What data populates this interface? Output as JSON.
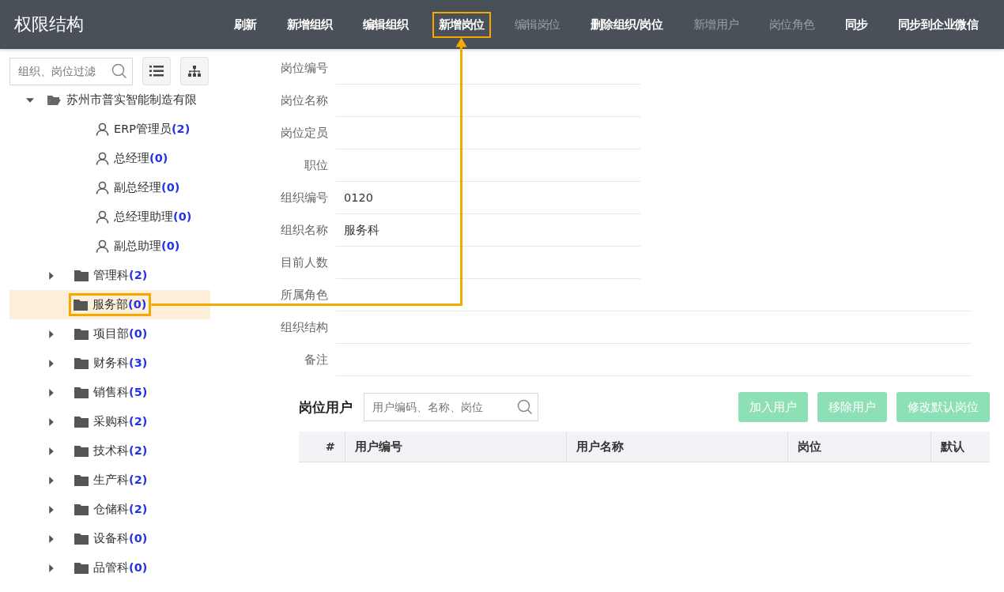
{
  "header": {
    "title": "权限结构"
  },
  "toolbar": [
    {
      "label": "刷新",
      "disabled": false,
      "highlighted": false
    },
    {
      "label": "新增组织",
      "disabled": false,
      "highlighted": false
    },
    {
      "label": "编辑组织",
      "disabled": false,
      "highlighted": false
    },
    {
      "label": "新增岗位",
      "disabled": false,
      "highlighted": true
    },
    {
      "label": "编辑岗位",
      "disabled": true,
      "highlighted": false
    },
    {
      "label": "删除组织/岗位",
      "disabled": false,
      "highlighted": false
    },
    {
      "label": "新增用户",
      "disabled": true,
      "highlighted": false
    },
    {
      "label": "岗位角色",
      "disabled": true,
      "highlighted": false
    },
    {
      "label": "同步",
      "disabled": false,
      "highlighted": false
    },
    {
      "label": "同步到企业微信",
      "disabled": false,
      "highlighted": false
    }
  ],
  "sidebar": {
    "search": {
      "placeholder": "组织、岗位过滤"
    },
    "tree": [
      {
        "kind": "org",
        "name": "苏州市普实智能制造有限",
        "expanded": true,
        "selected": false,
        "highlighted": false,
        "children": [
          {
            "kind": "post",
            "name": "ERP管理员",
            "count": "(2)",
            "selected": false,
            "highlighted": false
          },
          {
            "kind": "post",
            "name": "总经理",
            "count": "(0)",
            "selected": false,
            "highlighted": false
          },
          {
            "kind": "post",
            "name": "副总经理",
            "count": "(0)",
            "selected": false,
            "highlighted": false
          },
          {
            "kind": "post",
            "name": "总经理助理",
            "count": "(0)",
            "selected": false,
            "highlighted": false
          },
          {
            "kind": "post",
            "name": "副总助理",
            "count": "(0)",
            "selected": false,
            "highlighted": false
          },
          {
            "kind": "dept",
            "name": "管理科",
            "count": "(2)",
            "expandable": true,
            "selected": false,
            "highlighted": false
          },
          {
            "kind": "dept",
            "name": "服务部",
            "count": "(0)",
            "expandable": false,
            "selected": true,
            "highlighted": true
          },
          {
            "kind": "dept",
            "name": "项目部",
            "count": "(0)",
            "expandable": true,
            "selected": false,
            "highlighted": false
          },
          {
            "kind": "dept",
            "name": "财务科",
            "count": "(3)",
            "expandable": true,
            "selected": false,
            "highlighted": false
          },
          {
            "kind": "dept",
            "name": "销售科",
            "count": "(5)",
            "expandable": true,
            "selected": false,
            "highlighted": false
          },
          {
            "kind": "dept",
            "name": "采购科",
            "count": "(2)",
            "expandable": true,
            "selected": false,
            "highlighted": false
          },
          {
            "kind": "dept",
            "name": "技术科",
            "count": "(2)",
            "expandable": true,
            "selected": false,
            "highlighted": false
          },
          {
            "kind": "dept",
            "name": "生产科",
            "count": "(2)",
            "expandable": true,
            "selected": false,
            "highlighted": false
          },
          {
            "kind": "dept",
            "name": "仓储科",
            "count": "(2)",
            "expandable": true,
            "selected": false,
            "highlighted": false
          },
          {
            "kind": "dept",
            "name": "设备科",
            "count": "(0)",
            "expandable": true,
            "selected": false,
            "highlighted": false
          },
          {
            "kind": "dept",
            "name": "品管科",
            "count": "(0)",
            "expandable": true,
            "selected": false,
            "highlighted": false
          }
        ]
      }
    ]
  },
  "form": [
    {
      "label": "岗位编号",
      "wide": false
    },
    {
      "label": "岗位名称",
      "wide": false
    },
    {
      "label": "岗位定员",
      "wide": false
    },
    {
      "label": "职位",
      "wide": false
    },
    {
      "label": "组织编号",
      "value": "0120",
      "wide": false
    },
    {
      "label": "组织名称",
      "value": "服务科",
      "wide": false
    },
    {
      "label": "目前人数",
      "wide": false
    },
    {
      "label": "所属角色",
      "wide": true
    },
    {
      "label": "组织结构",
      "wide": true
    },
    {
      "label": "备注",
      "wide": true
    }
  ],
  "users": {
    "title": "岗位用户",
    "search": {
      "placeholder": "用户编码、名称、岗位"
    },
    "buttons": [
      {
        "label": "加入用户",
        "disabled": true
      },
      {
        "label": "移除用户",
        "disabled": true
      },
      {
        "label": "修改默认岗位",
        "disabled": true
      }
    ],
    "columns": [
      "#",
      "用户编号",
      "用户名称",
      "岗位",
      "默认"
    ]
  }
}
